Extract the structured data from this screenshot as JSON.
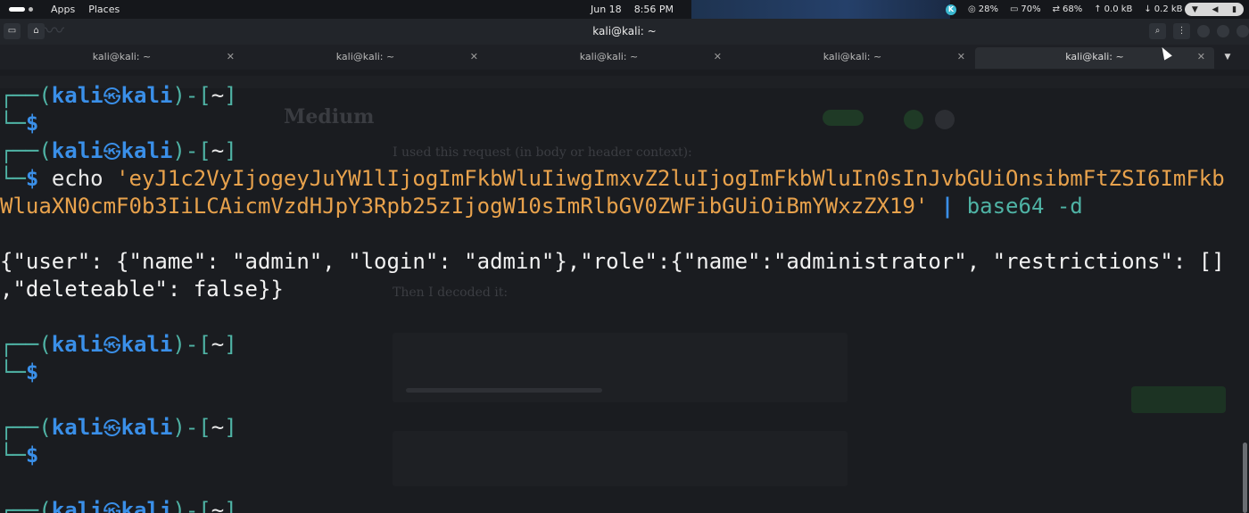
{
  "system_panel": {
    "menus": [
      "Apps",
      "Places"
    ],
    "date": "Jun 18",
    "time": "8:56 PM",
    "cpu": "28%",
    "memory": "70%",
    "swap": "68%",
    "net_up": "0.0 kB",
    "net_down": "0.2 kB"
  },
  "window": {
    "title": "kali@kali: ~"
  },
  "tabs": [
    {
      "label": "kali@kali: ~",
      "active": false
    },
    {
      "label": "kali@kali: ~",
      "active": false
    },
    {
      "label": "kali@kali: ~",
      "active": false
    },
    {
      "label": "kali@kali: ~",
      "active": false
    },
    {
      "label": "kali@kali: ~",
      "active": true
    }
  ],
  "terminal": {
    "prompt": {
      "frame_open": "┌──(",
      "user": "kali",
      "host": "kali",
      "frame_close": ")-[",
      "dir": "~",
      "dir_close": "]",
      "frame_bottom": "└─",
      "symbol": "$"
    },
    "command": {
      "cmd": "echo",
      "arg_line1": "'eyJ1c2VyIjogeyJuYW1lIjogImFkbWluIiwgImxvZ2luIjogImFkbWluIn0sInJvbGUiOnsibmFtZSI6ImFkb",
      "arg_line2": "WluaXN0cmF0b3IiLCAicmVzdHJpY3Rpb25zIjogW10sImRlbGV0ZWFibGUiOiBmYWxzZX19'",
      "pipe": "|",
      "pipe_cmd": "base64 -d"
    },
    "output_line1": "{\"user\": {\"name\": \"admin\", \"login\": \"admin\"},\"role\":{\"name\":\"administrator\", \"restrictions\": []",
    "output_line2": ",\"deleteable\": false}}"
  },
  "background_ghost": {
    "logo": "Medium",
    "body_line1": "I used this request (in body or header context):",
    "body_line2": "Then I decoded it:"
  }
}
